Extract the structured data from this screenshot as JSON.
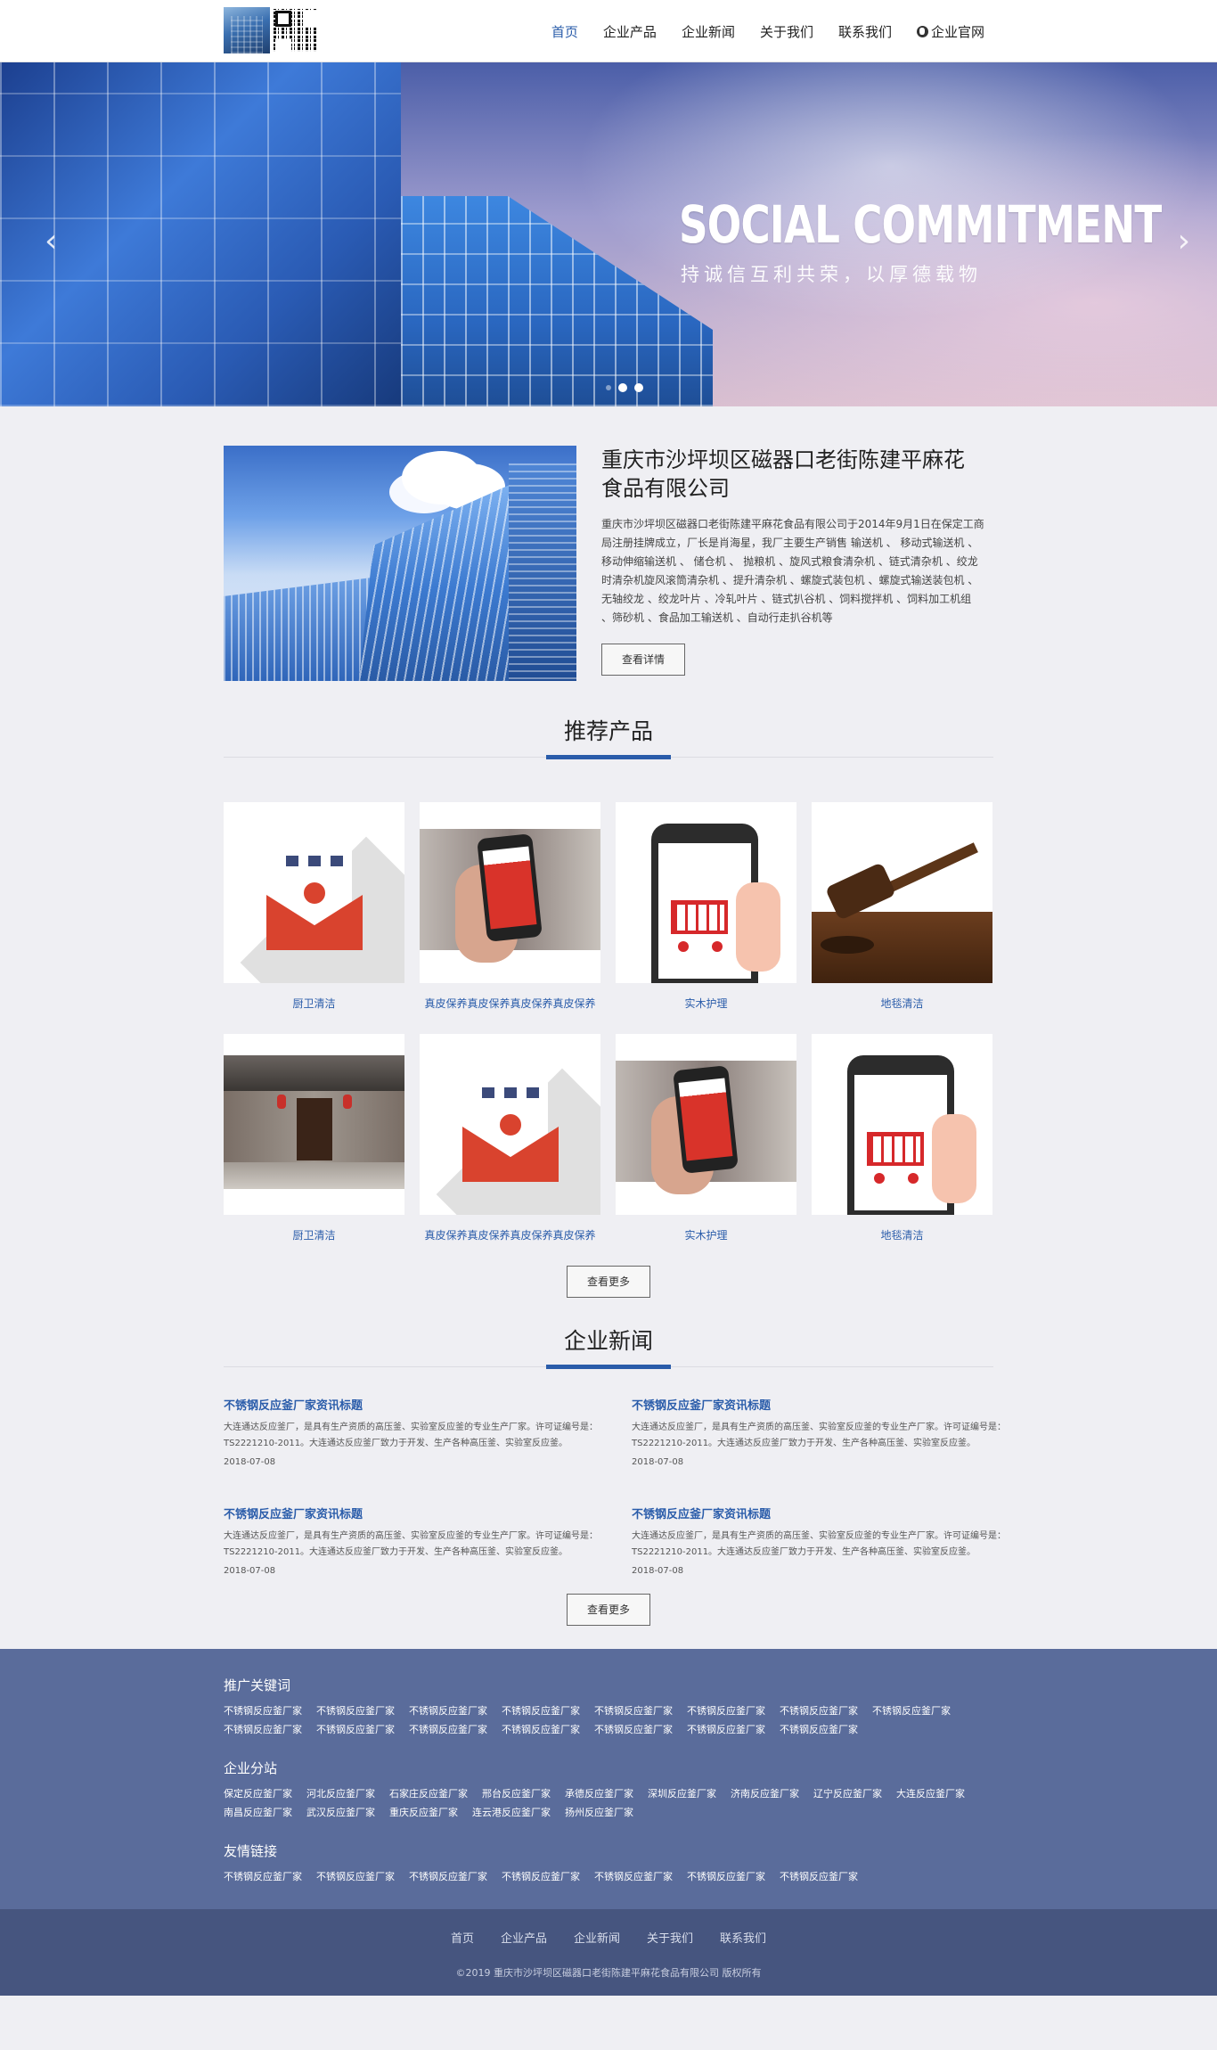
{
  "nav": {
    "items": [
      "首页",
      "企业产品",
      "企业新闻",
      "关于我们",
      "联系我们"
    ],
    "official": "企业官网",
    "active_index": 0
  },
  "banner": {
    "title": "SOCIAL COMMITMENT",
    "subtitle": "持诚信互利共荣，以厚德载物",
    "prev_icon": "chevron-left-icon",
    "next_icon": "chevron-right-icon"
  },
  "intro": {
    "title": "重庆市沙坪坝区磁器口老街陈建平麻花食品有限公司",
    "text": "重庆市沙坪坝区磁器口老街陈建平麻花食品有限公司于2014年9月1日在保定工商局注册挂牌成立，厂长是肖海星，我厂主要生产销售 输送机 、 移动式输送机 、移动伸缩输送机 、 储仓机 、 抛粮机 、旋风式粮食清杂机 、链式清杂机 、绞龙时清杂机旋风滚筒清杂机 、提升清杂机 、螺旋式装包机 、螺旋式输送装包机 、无轴绞龙 、绞龙叶片 、冷轧叶片 、链式扒谷机 、饲料搅拌机 、饲料加工机组 、筛砂机 、食品加工输送机 、自动行走扒谷机等",
    "button": "查看详情"
  },
  "products": {
    "title": "推荐产品",
    "items": [
      {
        "name": "厨卫清洁",
        "image": "envelope"
      },
      {
        "name": "真皮保养真皮保养真皮保养真皮保养",
        "image": "phone"
      },
      {
        "name": "实木护理",
        "image": "cart"
      },
      {
        "name": "地毯清洁",
        "image": "gavel"
      },
      {
        "name": "厨卫清洁",
        "image": "house"
      },
      {
        "name": "真皮保养真皮保养真皮保养真皮保养",
        "image": "envelope"
      },
      {
        "name": "实木护理",
        "image": "phone"
      },
      {
        "name": "地毯清洁",
        "image": "cart"
      }
    ],
    "more": "查看更多"
  },
  "news": {
    "title": "企业新闻",
    "items": [
      {
        "title": "不锈钢反应釜厂家资讯标题",
        "summary": "大连通达反应釜厂，是具有生产资质的高压釜、实验室反应釜的专业生产厂家。许可证编号是：TS2221210-2011。大连通达反应釜厂致力于开发、生产各种高压釜、实验室反应釜。",
        "date": "2018-07-08"
      },
      {
        "title": "不锈钢反应釜厂家资讯标题",
        "summary": "大连通达反应釜厂，是具有生产资质的高压釜、实验室反应釜的专业生产厂家。许可证编号是：TS2221210-2011。大连通达反应釜厂致力于开发、生产各种高压釜、实验室反应釜。",
        "date": "2018-07-08"
      },
      {
        "title": "不锈钢反应釜厂家资讯标题",
        "summary": "大连通达反应釜厂，是具有生产资质的高压釜、实验室反应釜的专业生产厂家。许可证编号是：TS2221210-2011。大连通达反应釜厂致力于开发、生产各种高压釜、实验室反应釜。",
        "date": "2018-07-08"
      },
      {
        "title": "不锈钢反应釜厂家资讯标题",
        "summary": "大连通达反应釜厂，是具有生产资质的高压釜、实验室反应釜的专业生产厂家。许可证编号是：TS2221210-2011。大连通达反应釜厂致力于开发、生产各种高压釜、实验室反应釜。",
        "date": "2018-07-08"
      }
    ],
    "more": "查看更多"
  },
  "footer": {
    "keywords_title": "推广关键词",
    "keywords": [
      "不锈钢反应釜厂家",
      "不锈钢反应釜厂家",
      "不锈钢反应釜厂家",
      "不锈钢反应釜厂家",
      "不锈钢反应釜厂家",
      "不锈钢反应釜厂家",
      "不锈钢反应釜厂家",
      "不锈钢反应釜厂家",
      "不锈钢反应釜厂家",
      "不锈钢反应釜厂家",
      "不锈钢反应釜厂家",
      "不锈钢反应釜厂家",
      "不锈钢反应釜厂家",
      "不锈钢反应釜厂家",
      "不锈钢反应釜厂家"
    ],
    "branches_title": "企业分站",
    "branches": [
      "保定反应釜厂家",
      "河北反应釜厂家",
      "石家庄反应釜厂家",
      "邢台反应釜厂家",
      "承德反应釜厂家",
      "深圳反应釜厂家",
      "济南反应釜厂家",
      "辽宁反应釜厂家",
      "大连反应釜厂家",
      "南昌反应釜厂家",
      "武汉反应釜厂家",
      "重庆反应釜厂家",
      "连云港反应釜厂家",
      "扬州反应釜厂家"
    ],
    "friends_title": "友情链接",
    "friends": [
      "不锈钢反应釜厂家",
      "不锈钢反应釜厂家",
      "不锈钢反应釜厂家",
      "不锈钢反应釜厂家",
      "不锈钢反应釜厂家",
      "不锈钢反应釜厂家",
      "不锈钢反应釜厂家"
    ],
    "bottom_nav": [
      "首页",
      "企业产品",
      "企业新闻",
      "关于我们",
      "联系我们"
    ],
    "copyright": "©2019 重庆市沙坪坝区磁器口老街陈建平麻花食品有限公司 版权所有"
  },
  "colors": {
    "accent": "#2a5caa",
    "footer": "#5a6c9b",
    "footer_bottom": "#46557f"
  }
}
